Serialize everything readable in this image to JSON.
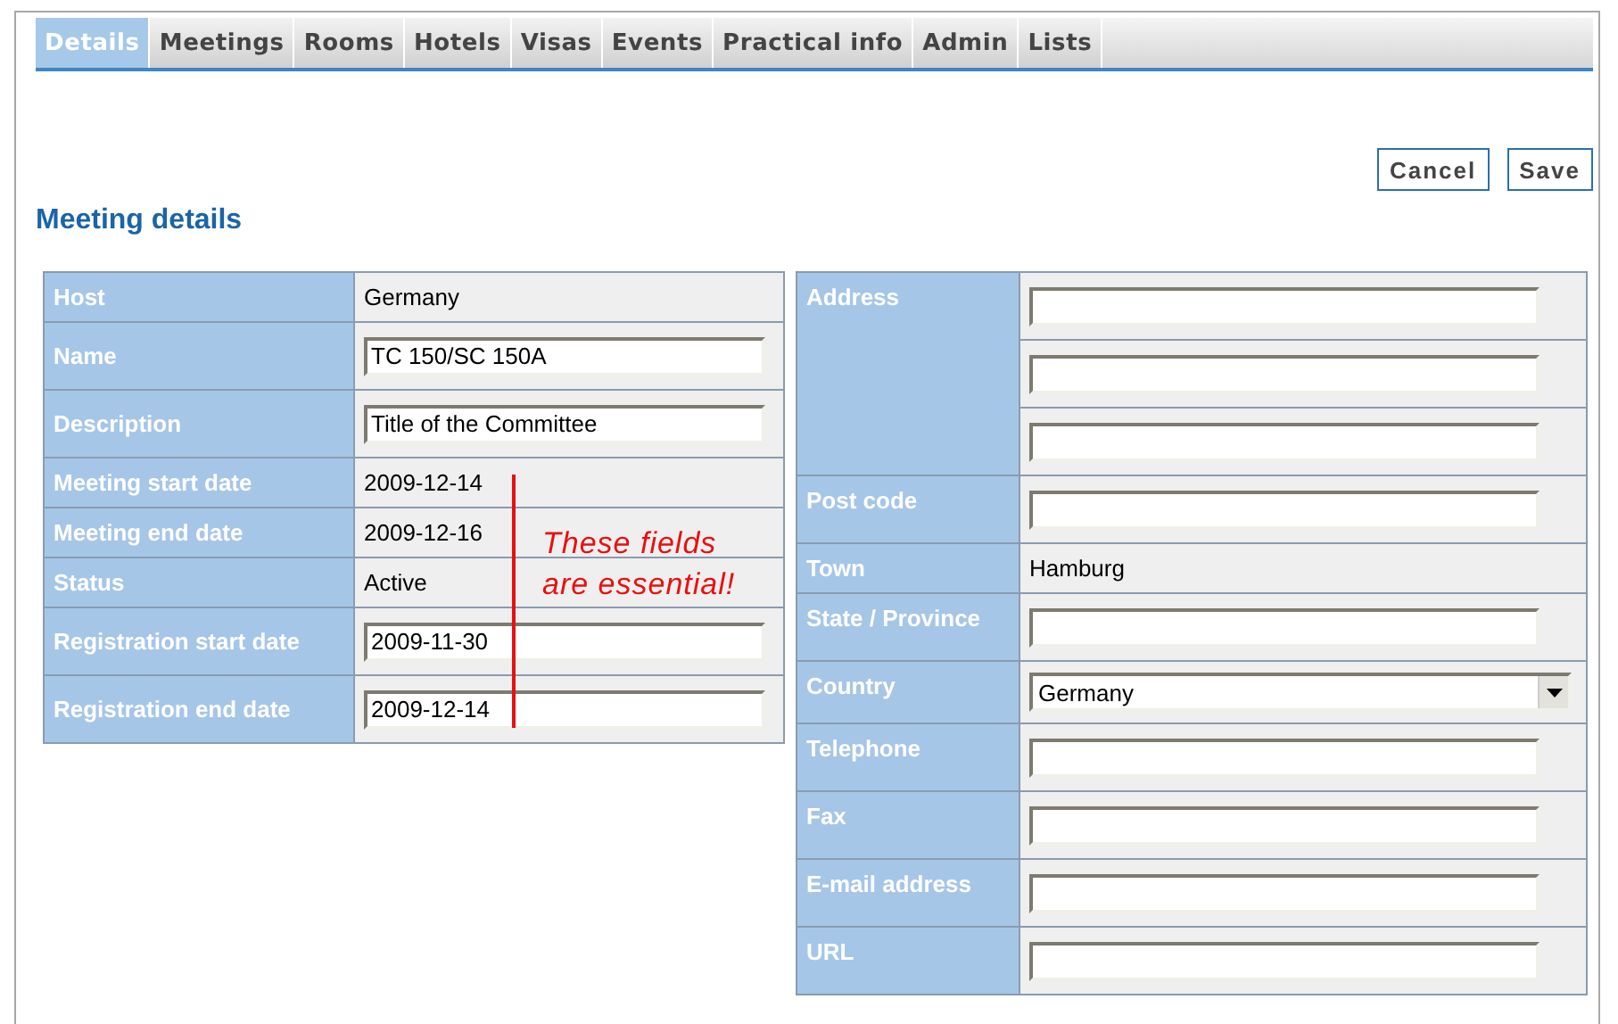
{
  "tabs": [
    {
      "label": "Details",
      "selected": true
    },
    {
      "label": "Meetings",
      "selected": false
    },
    {
      "label": "Rooms",
      "selected": false
    },
    {
      "label": "Hotels",
      "selected": false
    },
    {
      "label": "Visas",
      "selected": false
    },
    {
      "label": "Events",
      "selected": false
    },
    {
      "label": "Practical info",
      "selected": false
    },
    {
      "label": "Admin",
      "selected": false
    },
    {
      "label": "Lists",
      "selected": false
    }
  ],
  "buttons": [
    "Cancel",
    "Save"
  ],
  "heading": "Meeting details",
  "left_fields": [
    {
      "label": "Host",
      "kind": "text",
      "value": "Germany"
    },
    {
      "label": "Name",
      "kind": "input",
      "value": "TC 150/SC 150A"
    },
    {
      "label": "Description",
      "kind": "input",
      "value": "Title of the Committee"
    },
    {
      "label": "Meeting start date",
      "kind": "text",
      "value": "2009-12-14"
    },
    {
      "label": "Meeting end date",
      "kind": "text",
      "value": "2009-12-16"
    },
    {
      "label": "Status",
      "kind": "text",
      "value": "Active"
    },
    {
      "label": "Registration start date",
      "kind": "input",
      "value": "2009-11-30"
    },
    {
      "label": "Registration end date",
      "kind": "input",
      "value": "2009-12-14"
    }
  ],
  "annotation": [
    "These fields",
    "are essential!"
  ],
  "right_fields": [
    {
      "label": "Address",
      "kind": "multi_input",
      "fields": [
        {
          "kind": "input"
        },
        {
          "kind": "input"
        },
        {
          "kind": "input"
        }
      ]
    },
    {
      "label": "Post code",
      "kind": "input"
    },
    {
      "label": "Town",
      "kind": "text",
      "value": "Hamburg"
    },
    {
      "label": "State / Province",
      "kind": "input"
    },
    {
      "label": "Country",
      "kind": "select",
      "value": "Germany"
    },
    {
      "label": "Telephone",
      "kind": "input"
    },
    {
      "label": "Fax",
      "kind": "input"
    },
    {
      "label": "E-mail address",
      "kind": "input"
    },
    {
      "label": "URL",
      "kind": "input"
    }
  ]
}
